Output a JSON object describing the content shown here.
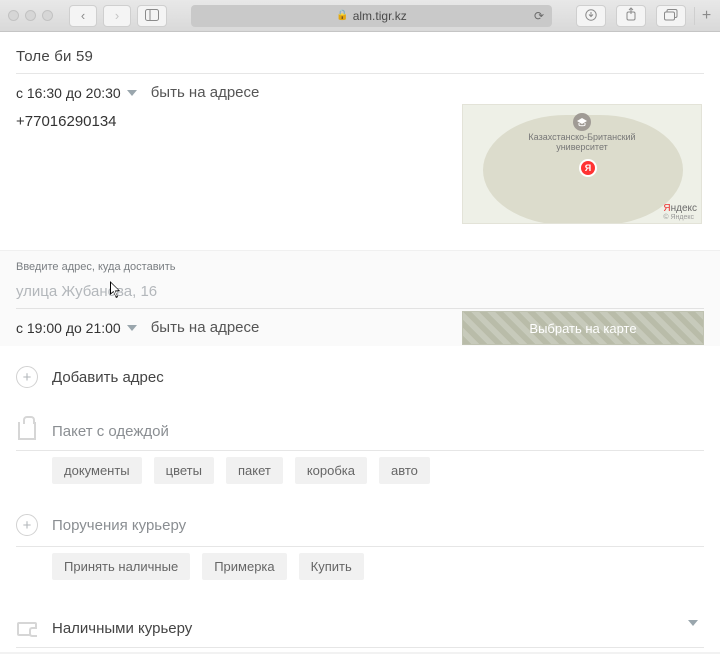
{
  "chrome": {
    "url_host": "alm.tigr.kz"
  },
  "pickup": {
    "address": "Толе  би 59",
    "time_label": "с 16:30 до 20:30",
    "note": "быть на адресе",
    "phone": "+77016290134"
  },
  "map1": {
    "poi": "Казахстанско-Британский университет",
    "pin_letter": "Я",
    "brand1": "Я",
    "brand2": "ндекс",
    "brand_sub": "© Яндекс"
  },
  "delivery": {
    "label": "Введите адрес, куда доставить",
    "placeholder": "улица Жубанова, 16",
    "time_label": "с 19:00 до 21:00",
    "note": "быть на адресе",
    "map_button": "Выбрать на карте"
  },
  "add_address": {
    "title": "Добавить адрес"
  },
  "package": {
    "title": "Пакет с одеждой",
    "chips": [
      "документы",
      "цветы",
      "пакет",
      "коробка",
      "авто"
    ]
  },
  "tasks": {
    "title": "Поручения курьеру",
    "chips": [
      "Принять наличные",
      "Примерка",
      "Купить"
    ]
  },
  "payment": {
    "title": "Наличными курьеру"
  }
}
